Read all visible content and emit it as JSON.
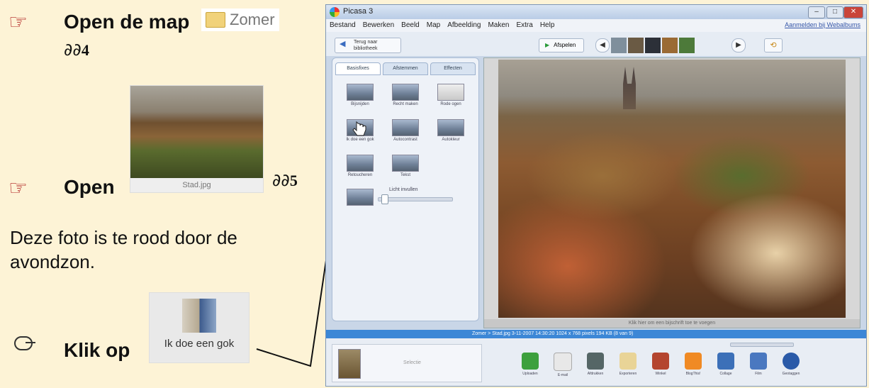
{
  "instructions": {
    "step1": {
      "label": "Open de map",
      "folder_name": "Zomer",
      "feet_number": "4"
    },
    "step2": {
      "label": "Open",
      "thumb_caption": "Stad.jpg",
      "feet_number": "5"
    },
    "note": "Deze foto is te rood door de avondzon.",
    "step3": {
      "label": "Klik op",
      "button_label": "Ik doe een gok"
    }
  },
  "picasa": {
    "title": "Picasa 3",
    "menu": [
      "Bestand",
      "Bewerken",
      "Beeld",
      "Map",
      "Afbeelding",
      "Maken",
      "Extra",
      "Help"
    ],
    "signin_link": "Aanmelden bij Webalbums",
    "back_button": "Terug naar bibliotheek",
    "play_button": "Afspelen",
    "tabs": [
      "Basisfixes",
      "Afstemmen",
      "Effecten"
    ],
    "fixes": [
      "Bijsnijden",
      "Recht maken",
      "Rode ogen",
      "Ik doe een gok",
      "Autocontrast",
      "Autokleur",
      "Retoucheren",
      "Tekst"
    ],
    "slider_label": "Licht invullen",
    "viewer_caption": "Klik hier om een bijschrift toe te voegen",
    "status_text": "Zomer > Stad.jpg    3-11-2007 14:30:20    1024 x 768 pixels    194 KB    (8 van 9)",
    "tray_label": "Selectie",
    "bottom_buttons": [
      "Uploaden",
      "E-mail",
      "Afdrukken",
      "Exporteren",
      "Winkel",
      "BlogThis!",
      "Collage",
      "Film",
      "Geotaggen"
    ]
  }
}
